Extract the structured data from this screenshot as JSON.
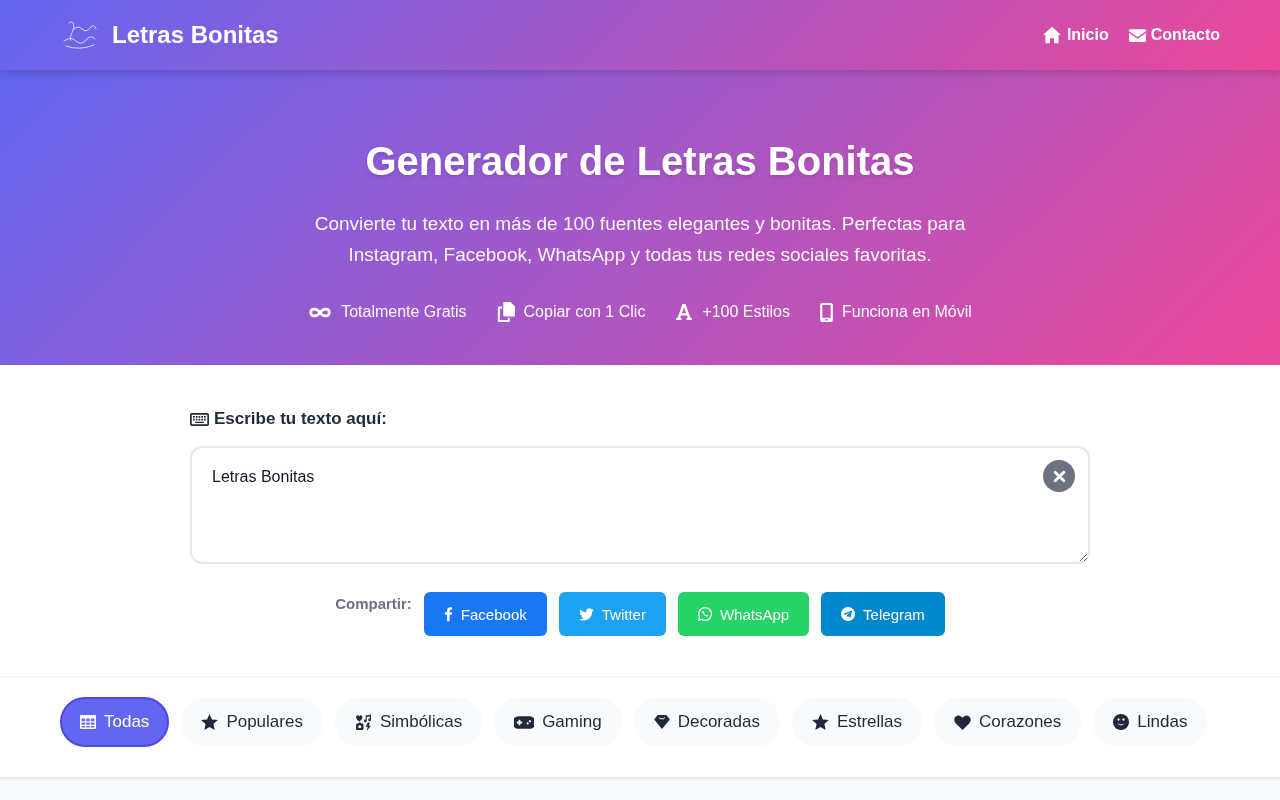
{
  "header": {
    "title": "Letras Bonitas",
    "nav": [
      {
        "label": "Inicio"
      },
      {
        "label": "Contacto"
      }
    ]
  },
  "hero": {
    "title": "Generador de Letras Bonitas",
    "subtitle": "Convierte tu texto en más de 100 fuentes elegantes y bonitas. Perfectas para Instagram, Facebook, WhatsApp y todas tus redes sociales favoritas.",
    "features": [
      {
        "label": "Totalmente Gratis"
      },
      {
        "label": "Copiar con 1 Clic"
      },
      {
        "label": "+100 Estilos"
      },
      {
        "label": "Funciona en Móvil"
      }
    ]
  },
  "editor": {
    "label": "Escribe tu texto aquí:",
    "value": "Letras Bonitas"
  },
  "share": {
    "label": "Compartir:",
    "buttons": [
      {
        "label": "Facebook",
        "color": "#1877f2"
      },
      {
        "label": "Twitter",
        "color": "#1da1f2"
      },
      {
        "label": "WhatsApp",
        "color": "#25d366"
      },
      {
        "label": "Telegram",
        "color": "#0088cc"
      }
    ]
  },
  "categories": [
    {
      "label": "Todas",
      "selected": true
    },
    {
      "label": "Populares",
      "selected": false
    },
    {
      "label": "Simbólicas",
      "selected": false
    },
    {
      "label": "Gaming",
      "selected": false
    },
    {
      "label": "Decoradas",
      "selected": false
    },
    {
      "label": "Estrellas",
      "selected": false
    },
    {
      "label": "Corazones",
      "selected": false
    },
    {
      "label": "Lindas",
      "selected": false
    }
  ]
}
